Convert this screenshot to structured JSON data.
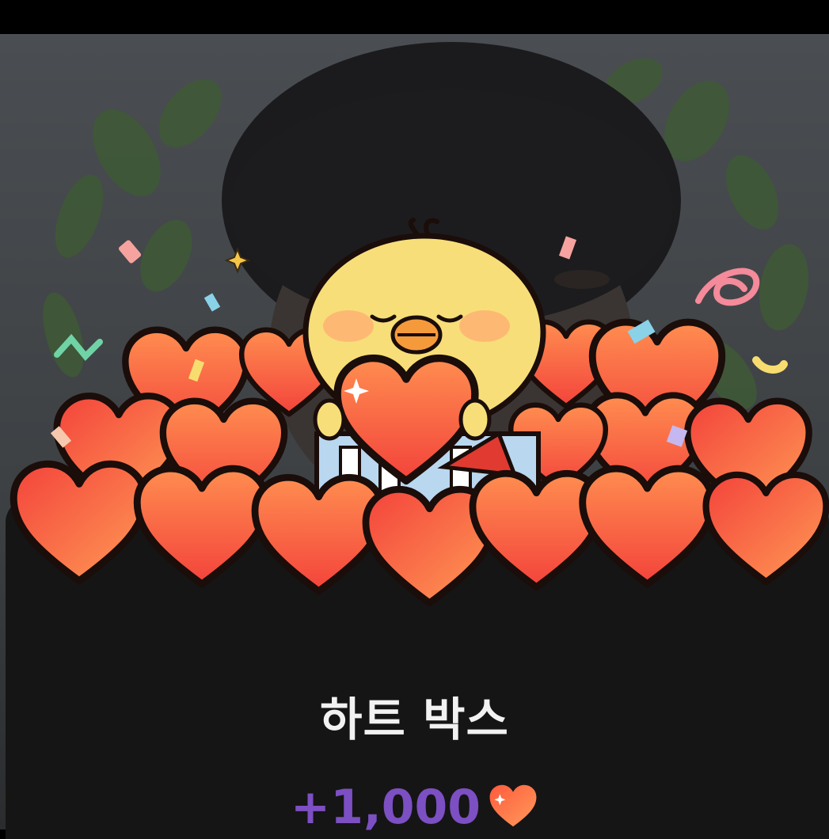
{
  "gift": {
    "title": "하트 박스",
    "amount": "+1,000",
    "currency_icon": "heart-icon",
    "character": "yellow-chick-character"
  },
  "colors": {
    "heart_top": "#ff8a4c",
    "heart_bottom": "#f4403a",
    "amount_purple": "#7c4fc2",
    "sheet_bg": "#151515",
    "chick_yellow": "#f8de78"
  }
}
